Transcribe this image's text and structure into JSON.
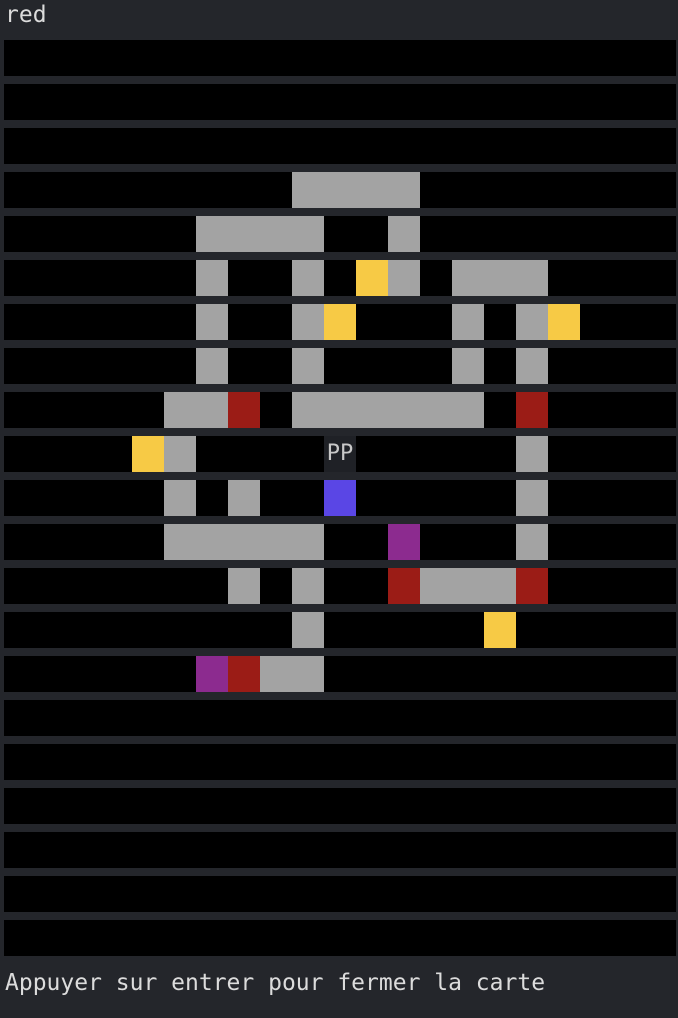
{
  "header": {
    "label": "red"
  },
  "footer": {
    "hint": "Appuyer sur entrer pour fermer la carte"
  },
  "legend": {
    "wall": "#a3a3a3",
    "item": "#f7ca45",
    "door": "#9b1c16",
    "purple": "#8c2b8f",
    "blue": "#5a46e5",
    "player_bg": "#1f2126"
  },
  "map": {
    "rows": 21,
    "cols": 21,
    "player": {
      "text": "PP"
    },
    "cells": [
      {
        "r": 3,
        "c": 9,
        "w": 4,
        "type": "wall"
      },
      {
        "r": 4,
        "c": 6,
        "w": 4,
        "type": "wall"
      },
      {
        "r": 4,
        "c": 12,
        "w": 1,
        "type": "wall"
      },
      {
        "r": 5,
        "c": 6,
        "w": 1,
        "type": "wall"
      },
      {
        "r": 5,
        "c": 9,
        "w": 1,
        "type": "wall"
      },
      {
        "r": 5,
        "c": 11,
        "w": 1,
        "type": "item"
      },
      {
        "r": 5,
        "c": 12,
        "w": 1,
        "type": "wall"
      },
      {
        "r": 5,
        "c": 14,
        "w": 3,
        "type": "wall"
      },
      {
        "r": 6,
        "c": 6,
        "w": 1,
        "type": "wall"
      },
      {
        "r": 6,
        "c": 9,
        "w": 1,
        "type": "wall"
      },
      {
        "r": 6,
        "c": 10,
        "w": 1,
        "type": "item"
      },
      {
        "r": 6,
        "c": 14,
        "w": 1,
        "type": "wall"
      },
      {
        "r": 6,
        "c": 16,
        "w": 1,
        "type": "wall"
      },
      {
        "r": 6,
        "c": 17,
        "w": 1,
        "type": "item"
      },
      {
        "r": 7,
        "c": 6,
        "w": 1,
        "type": "wall"
      },
      {
        "r": 7,
        "c": 9,
        "w": 1,
        "type": "wall"
      },
      {
        "r": 7,
        "c": 14,
        "w": 1,
        "type": "wall"
      },
      {
        "r": 7,
        "c": 16,
        "w": 1,
        "type": "wall"
      },
      {
        "r": 8,
        "c": 5,
        "w": 2,
        "type": "wall"
      },
      {
        "r": 8,
        "c": 7,
        "w": 1,
        "type": "door"
      },
      {
        "r": 8,
        "c": 9,
        "w": 6,
        "type": "wall"
      },
      {
        "r": 8,
        "c": 16,
        "w": 1,
        "type": "door"
      },
      {
        "r": 9,
        "c": 4,
        "w": 1,
        "type": "item"
      },
      {
        "r": 9,
        "c": 5,
        "w": 1,
        "type": "wall"
      },
      {
        "r": 9,
        "c": 10,
        "w": 1,
        "type": "player"
      },
      {
        "r": 9,
        "c": 16,
        "w": 1,
        "type": "wall"
      },
      {
        "r": 10,
        "c": 5,
        "w": 1,
        "type": "wall"
      },
      {
        "r": 10,
        "c": 7,
        "w": 1,
        "type": "wall"
      },
      {
        "r": 10,
        "c": 10,
        "w": 1,
        "type": "blue"
      },
      {
        "r": 10,
        "c": 16,
        "w": 1,
        "type": "wall"
      },
      {
        "r": 11,
        "c": 5,
        "w": 5,
        "type": "wall"
      },
      {
        "r": 11,
        "c": 12,
        "w": 1,
        "type": "purple"
      },
      {
        "r": 11,
        "c": 16,
        "w": 1,
        "type": "wall"
      },
      {
        "r": 12,
        "c": 7,
        "w": 1,
        "type": "wall"
      },
      {
        "r": 12,
        "c": 9,
        "w": 1,
        "type": "wall"
      },
      {
        "r": 12,
        "c": 12,
        "w": 1,
        "type": "door"
      },
      {
        "r": 12,
        "c": 13,
        "w": 3,
        "type": "wall"
      },
      {
        "r": 12,
        "c": 16,
        "w": 1,
        "type": "door"
      },
      {
        "r": 13,
        "c": 9,
        "w": 1,
        "type": "wall"
      },
      {
        "r": 13,
        "c": 15,
        "w": 1,
        "type": "item"
      },
      {
        "r": 14,
        "c": 6,
        "w": 1,
        "type": "purple"
      },
      {
        "r": 14,
        "c": 7,
        "w": 1,
        "type": "door"
      },
      {
        "r": 14,
        "c": 8,
        "w": 2,
        "type": "wall"
      }
    ]
  }
}
